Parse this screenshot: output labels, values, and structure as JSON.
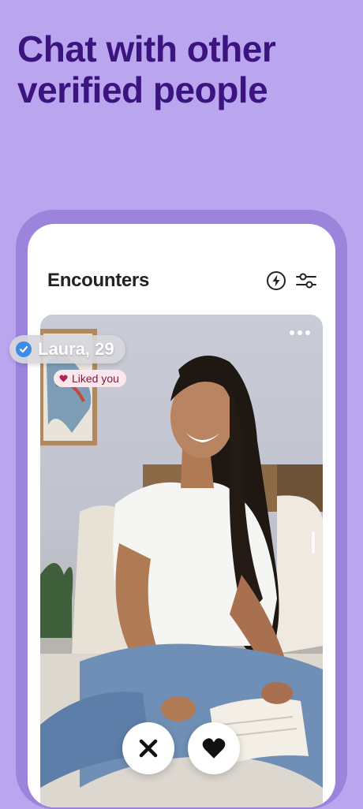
{
  "promo": {
    "headline_line1": "Chat with other",
    "headline_line2": "verified people"
  },
  "app": {
    "title": "Encounters"
  },
  "header_icons": [
    "lightning-icon",
    "filters-icon"
  ],
  "profile": {
    "name_age": "Laura, 29",
    "liked_badge": "Liked you",
    "verified": true
  },
  "actions": [
    "pass-button",
    "like-button"
  ],
  "colors": {
    "background": "#b9a6ee",
    "headline": "#3b1480",
    "phone_frame": "#9c83dc",
    "verified_badge": "#3c8ce8",
    "liked_heart": "#b0234e"
  }
}
